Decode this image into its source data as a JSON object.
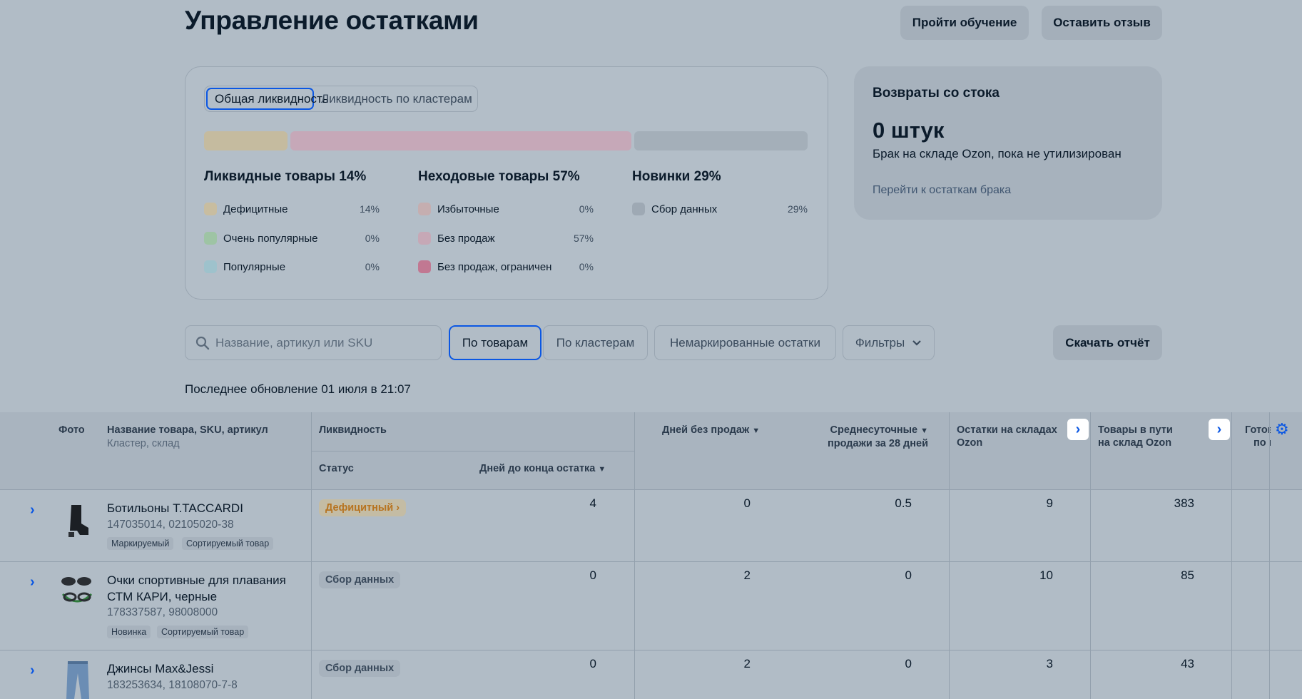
{
  "header": {
    "title": "Управление остатками",
    "learn_button": "Пройти обучение",
    "feedback_button": "Оставить отзыв"
  },
  "liquidity": {
    "tabs": [
      "Общая ликвидность",
      "Ликвидность по кластерам"
    ],
    "active_tab": 0,
    "bar_segments": [
      {
        "name": "Ликвидные",
        "percent": 14,
        "color": "#c5bb9f"
      },
      {
        "name": "Неходовые",
        "percent": 57,
        "color": "#c6a8b8"
      },
      {
        "name": "Новинки",
        "percent": 29,
        "color": "#a4afb9"
      }
    ],
    "groups": [
      {
        "title": "Ликвидные товары 14%",
        "items": [
          {
            "label": "Дефицитные",
            "pct": "14%",
            "color": "#c8bda0"
          },
          {
            "label": "Очень популярные",
            "pct": "0%",
            "color": "#9ec4a4"
          },
          {
            "label": "Популярные",
            "pct": "0%",
            "color": "#9ec2cc"
          }
        ]
      },
      {
        "title": "Неходовые товары 57%",
        "items": [
          {
            "label": "Избыточные",
            "pct": "0%",
            "color": "#c5aeb0"
          },
          {
            "label": "Без продаж",
            "pct": "57%",
            "color": "#c6a8b6"
          },
          {
            "label": "Без продаж, ограничен",
            "pct": "0%",
            "color": "#c17892"
          }
        ]
      },
      {
        "title": "Новинки 29%",
        "items": [
          {
            "label": "Сбор данных",
            "pct": "29%",
            "color": "#9ea9b4"
          }
        ]
      }
    ]
  },
  "returns": {
    "title": "Возвраты со стока",
    "count": "0 штук",
    "description": "Брак на складе Ozon, пока не утилизирован",
    "link": "Перейти к остаткам брака"
  },
  "toolbar": {
    "search_placeholder": "Название, артикул или SKU",
    "view_by_products": "По товарам",
    "view_by_clusters": "По кластерам",
    "unmarked": "Немаркированные остатки",
    "filters": "Фильтры",
    "download": "Скачать отчёт"
  },
  "last_update": "Последнее обновление 01 июля в 21:07",
  "table": {
    "headers": {
      "photo": "Фото",
      "name": "Название товара, SKU, артикул",
      "name_sub": "Кластер, склад",
      "liquidity": "Ликвидность",
      "status": "Статус",
      "days_left": "Дней до конца остатка",
      "days_no_sales": "Дней без продаж",
      "avg_sales_1": "Среднесуточные",
      "avg_sales_2": "продажи за 28 дней",
      "stock_1": "Остатки на складах",
      "stock_2": "Ozon",
      "transit_1": "Товары в пути",
      "transit_2": "на склад Ozon",
      "ready_1": "Готов",
      "ready_2": "по в"
    },
    "rows": [
      {
        "name_line1": "Ботильоны T.TACCARDI",
        "name_line2": "",
        "sku": "147035014, 02105020-38",
        "tags": [
          "Маркируемый",
          "Сортируемый товар"
        ],
        "status": "Дефицитный",
        "status_color": "#b7731f",
        "days_left": "4",
        "days_no_sales": "0",
        "avg_sales": "0.5",
        "stock": "9",
        "transit": "383"
      },
      {
        "name_line1": "Очки спортивные для плавания",
        "name_line2": "СТМ КАРИ, черные",
        "sku": "178337587, 98008000",
        "tags": [
          "Новинка",
          "Сортируемый товар"
        ],
        "status": "Сбор данных",
        "status_color": "#3a4a5c",
        "days_left": "0",
        "days_no_sales": "2",
        "avg_sales": "0",
        "stock": "10",
        "transit": "85"
      },
      {
        "name_line1": "Джинсы Max&Jessi",
        "name_line2": "",
        "sku": "183253634, 18108070-7-8",
        "tags": [],
        "status": "Сбор данных",
        "status_color": "#3a4a5c",
        "days_left": "0",
        "days_no_sales": "2",
        "avg_sales": "0",
        "stock": "3",
        "transit": "43"
      }
    ]
  }
}
